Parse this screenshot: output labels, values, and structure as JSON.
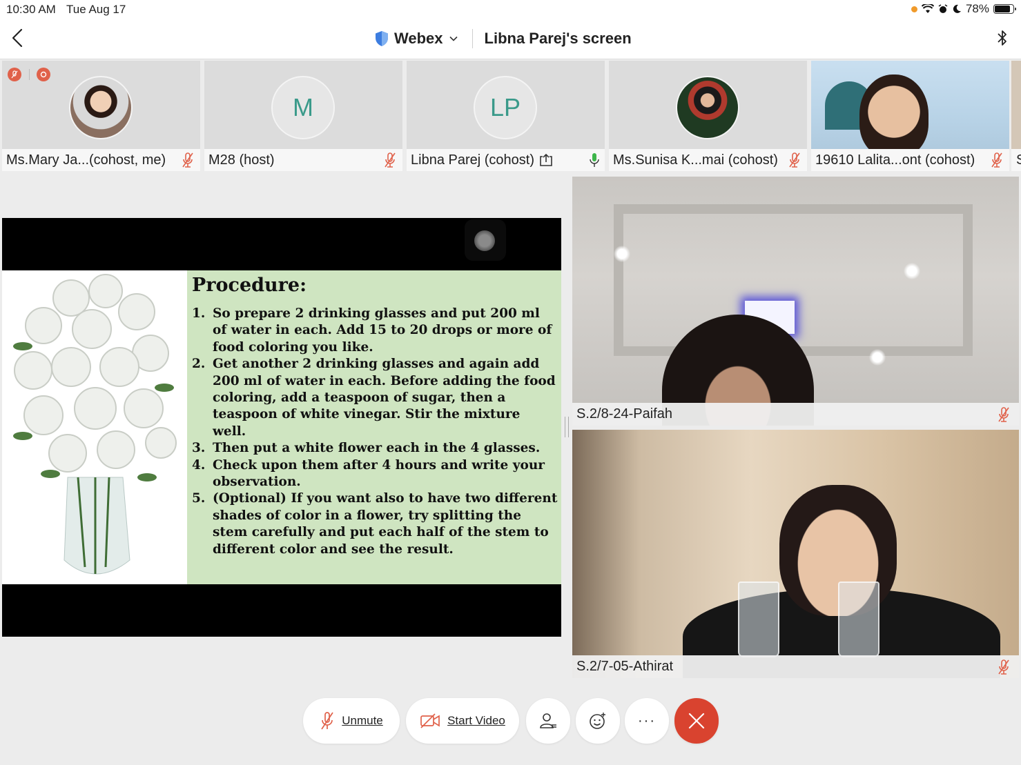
{
  "status_bar": {
    "time": "10:30 AM",
    "date": "Tue Aug 17",
    "battery": "78%"
  },
  "header": {
    "app_name": "Webex",
    "title": "Libna Parej's screen"
  },
  "participants": [
    {
      "name": "Ms.Mary Ja...(cohost, me)",
      "avatar": "photo",
      "mic": "muted"
    },
    {
      "name": "M28 (host)",
      "avatar_initials": "M",
      "mic": "muted"
    },
    {
      "name": "Libna Parej (cohost)",
      "avatar_initials": "LP",
      "mic": "on",
      "sharing": true
    },
    {
      "name": "Ms.Sunisa K...mai (cohost)",
      "avatar": "photo",
      "mic": "muted"
    },
    {
      "name": "19610 Lalita...ont (cohost)",
      "avatar": "video",
      "mic": "muted"
    },
    {
      "name": "S",
      "avatar": "video-clipped"
    }
  ],
  "slide": {
    "title": "Procedure:",
    "steps": [
      {
        "num": "1.",
        "text": "So prepare 2 drinking glasses and put 200 ml of water in each. Add 15 to 20 drops or more of food coloring you like."
      },
      {
        "num": "2.",
        "text": "Get another 2 drinking glasses and again add 200 ml of water in each. Before adding the food coloring, add a teaspoon of sugar, then a teaspoon of white vinegar. Stir the mixture well."
      },
      {
        "num": "3.",
        "text": "Then put a white flower each in the 4 glasses."
      },
      {
        "num": "4.",
        "text": "Check upon them after 4 hours and write your observation."
      },
      {
        "num": "5.",
        "text": "(Optional) If you want also to have two different shades of color in a flower, try splitting the stem carefully and put each half of the stem to different color and see the result."
      }
    ]
  },
  "videos": [
    {
      "name": "S.2/8-24-Paifah",
      "mic": "muted"
    },
    {
      "name": "S.2/7-05-Athirat",
      "mic": "muted"
    }
  ],
  "controls": {
    "unmute_label": "Unmute",
    "start_video_label": "Start Video",
    "more_label": "···"
  },
  "colors": {
    "muted_red": "#e0614a",
    "end_red": "#d9432f",
    "mic_green": "#3cb54a",
    "slide_green": "#cfe5c1",
    "initials_teal": "#3a9a8a"
  }
}
